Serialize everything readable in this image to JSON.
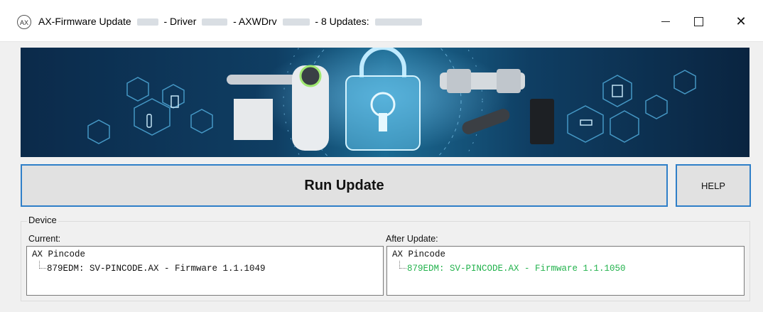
{
  "window": {
    "icon_text": "AX",
    "title_parts": {
      "app": "AX-Firmware Update",
      "driver_label": "- Driver",
      "axwdrv_label": "- AXWDrv",
      "updates_label": "-  8 Updates:"
    },
    "controls": {
      "minimize": "minimize",
      "maximize": "maximize",
      "close": "✕"
    }
  },
  "actions": {
    "run_update": "Run Update",
    "help": "HELP"
  },
  "device": {
    "group_label": "Device",
    "current": {
      "label": "Current:",
      "root": "AX Pincode",
      "child": "879EDM: SV-PINCODE.AX - Firmware 1.1.1049"
    },
    "after": {
      "label": "After Update:",
      "root": "AX Pincode",
      "child": "879EDM: SV-PINCODE.AX - Firmware 1.1.1050"
    }
  },
  "colors": {
    "accent_border": "#2f7fc8",
    "updated_text": "#22b24c"
  }
}
